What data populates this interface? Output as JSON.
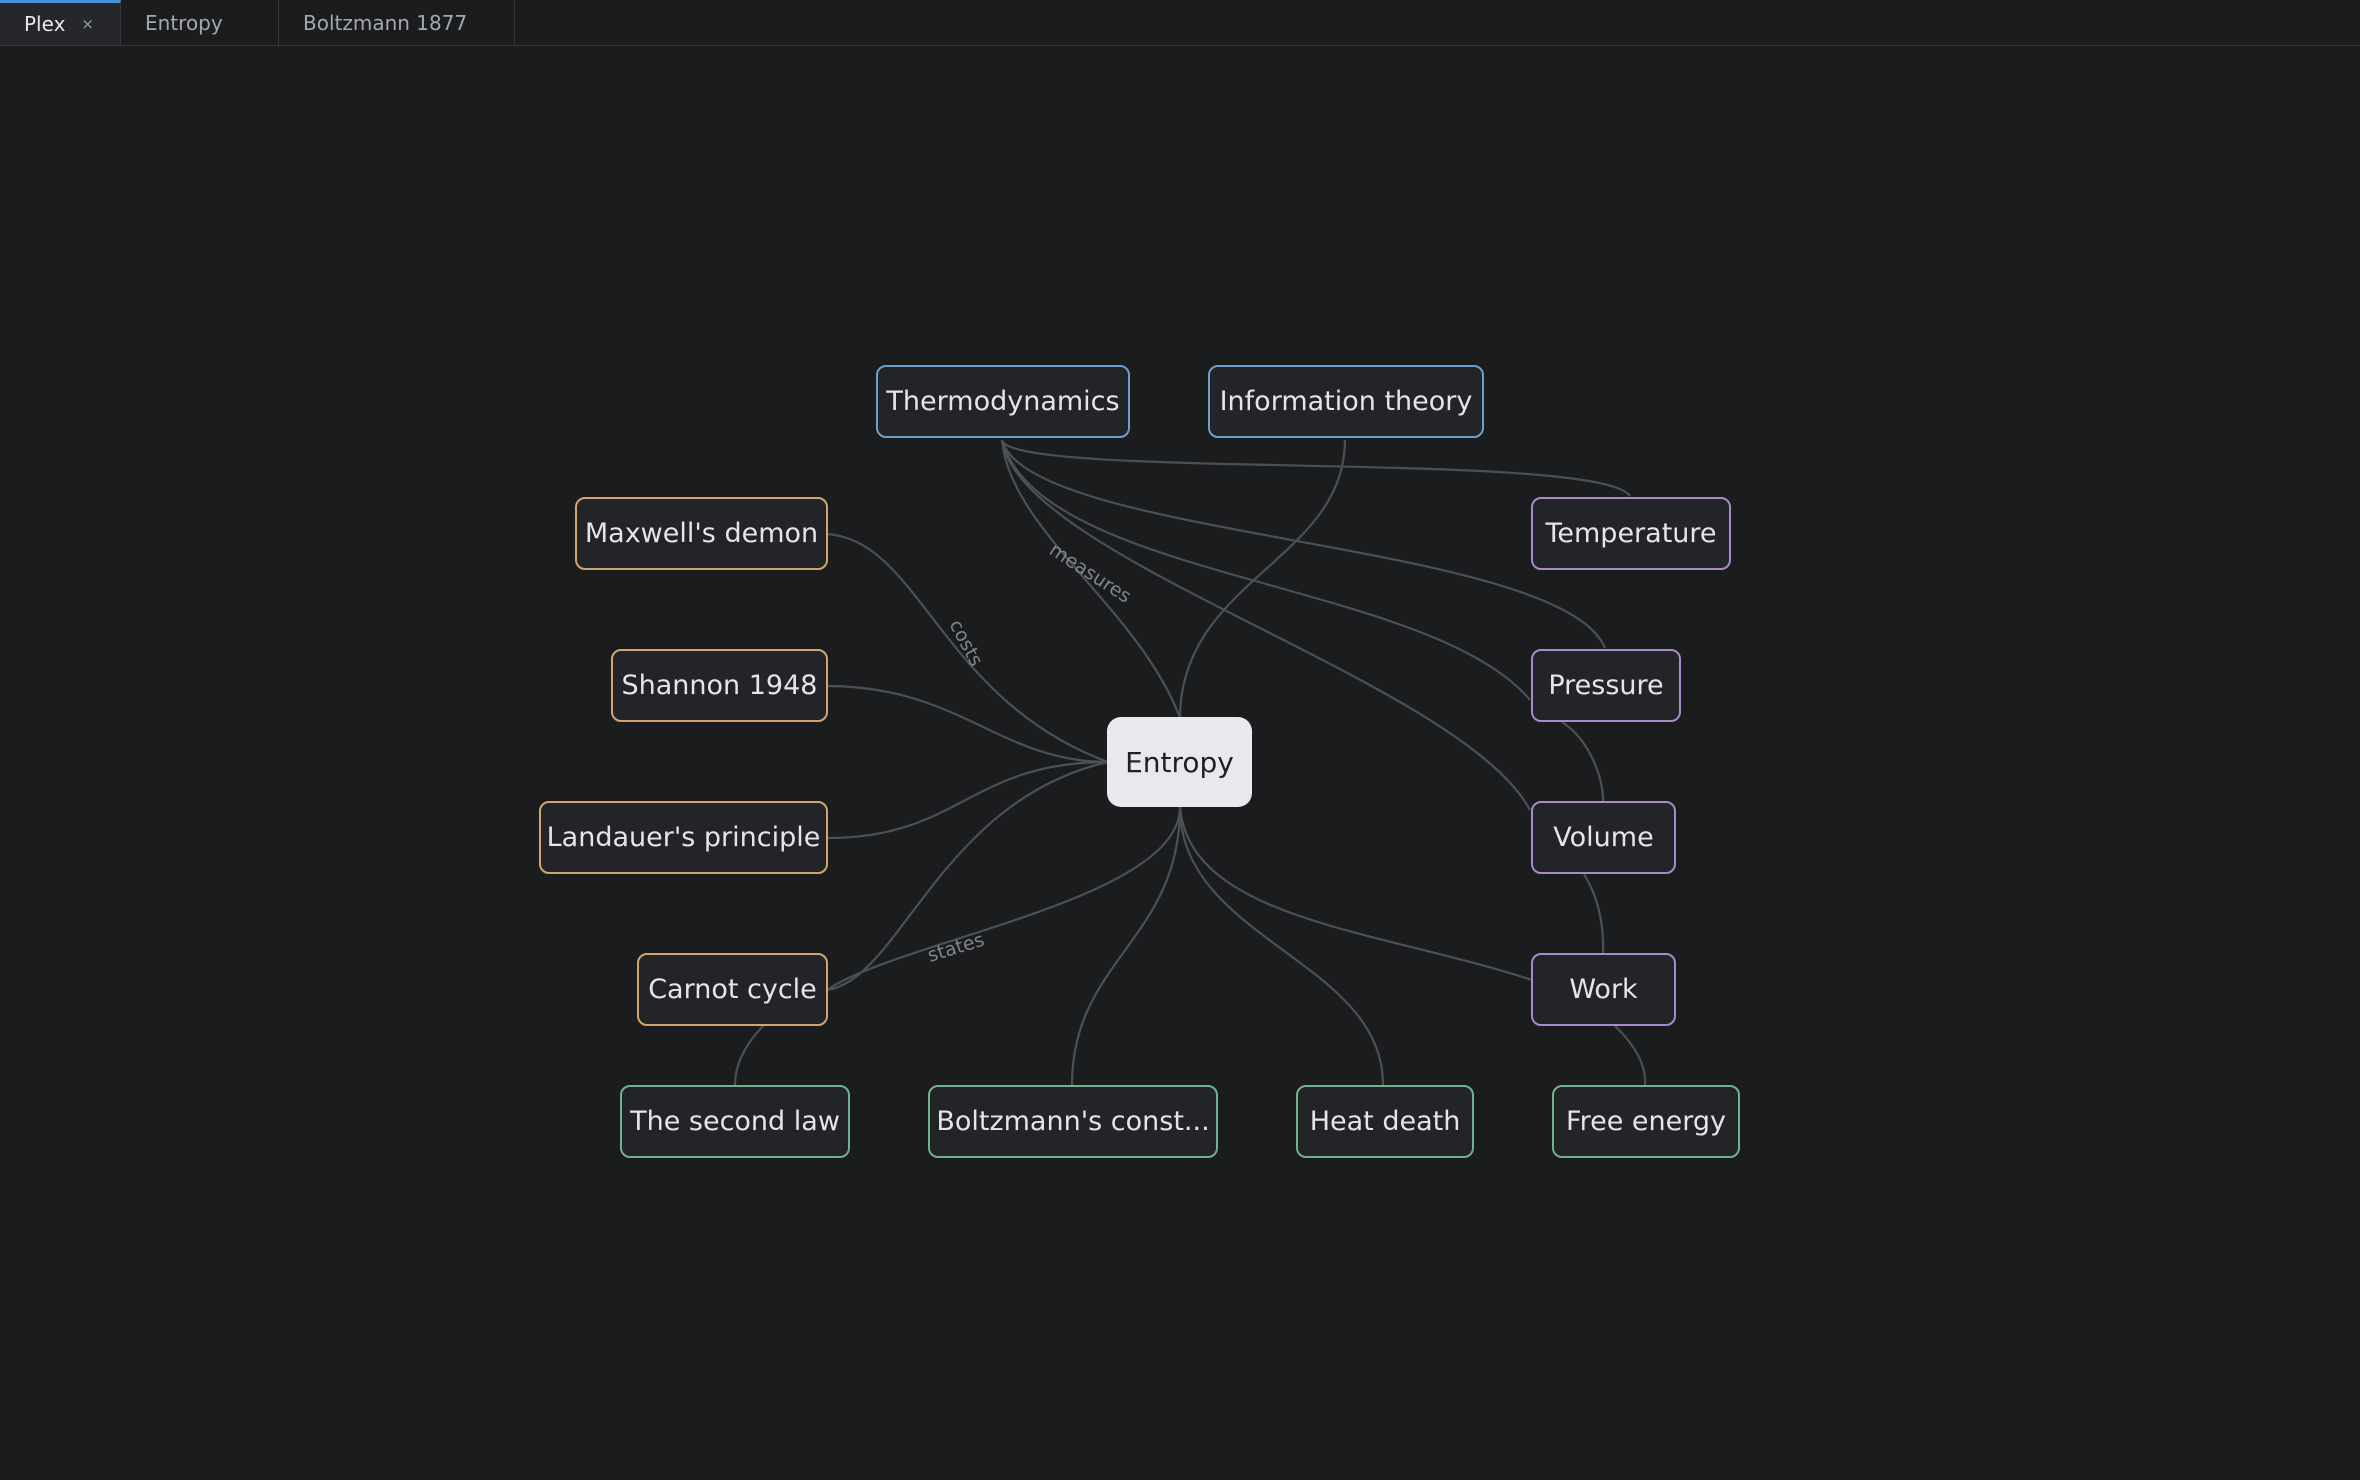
{
  "tabs": [
    {
      "label": "Plex",
      "active": true,
      "close_icon": "×"
    },
    {
      "label": "Entropy",
      "active": false
    },
    {
      "label": "Boltzmann 1877",
      "active": false
    }
  ],
  "colors": {
    "background": "#1b1c1e",
    "accent_tab": "#4a8fd6",
    "blue_group": "#6c9fce",
    "orange_group": "#d0a56e",
    "purple_group": "#a78bc9",
    "green_group": "#6fb28f",
    "edge": "#4b5055"
  },
  "graph": {
    "center": "Entropy",
    "nodes": {
      "thermodynamics": "Thermodynamics",
      "information_theory": "Information theory",
      "maxwells_demon": "Maxwell's demon",
      "shannon_1948": "Shannon 1948",
      "landauers_principle": "Landauer's principle",
      "carnot_cycle": "Carnot cycle",
      "temperature": "Temperature",
      "pressure": "Pressure",
      "volume": "Volume",
      "work": "Work",
      "second_law": "The second law",
      "boltzmanns_constant": "Boltzmann's const...",
      "heat_death": "Heat death",
      "free_energy": "Free energy"
    },
    "edge_labels": {
      "measures": "measures",
      "costs": "costs",
      "states": "states"
    },
    "edges": [
      [
        "thermodynamics",
        "entropy",
        "measures"
      ],
      [
        "information_theory",
        "entropy",
        ""
      ],
      [
        "maxwells_demon",
        "entropy",
        "costs"
      ],
      [
        "shannon_1948",
        "entropy",
        ""
      ],
      [
        "landauers_principle",
        "entropy",
        ""
      ],
      [
        "carnot_cycle",
        "entropy",
        "states"
      ],
      [
        "entropy",
        "carnot_cycle",
        ""
      ],
      [
        "entropy",
        "work",
        ""
      ],
      [
        "entropy",
        "boltzmanns_constant",
        ""
      ],
      [
        "entropy",
        "heat_death",
        ""
      ],
      [
        "thermodynamics",
        "temperature",
        ""
      ],
      [
        "thermodynamics",
        "pressure",
        ""
      ],
      [
        "thermodynamics",
        "volume",
        ""
      ],
      [
        "thermodynamics",
        "pressure",
        ""
      ],
      [
        "pressure",
        "volume",
        ""
      ],
      [
        "volume",
        "work",
        ""
      ],
      [
        "work",
        "free_energy",
        ""
      ],
      [
        "carnot_cycle",
        "second_law",
        ""
      ]
    ]
  }
}
